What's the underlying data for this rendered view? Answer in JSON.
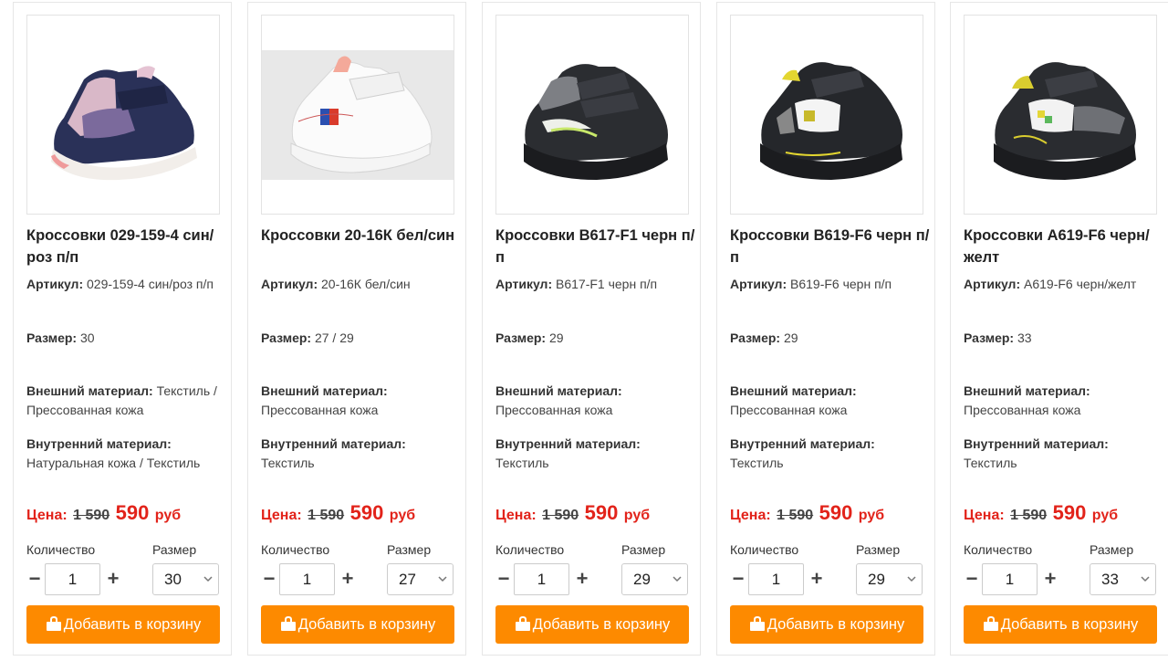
{
  "labels": {
    "article": "Артикул:",
    "size": "Размер:",
    "outer": "Внешний материал:",
    "inner": "Внутренний материал:",
    "price": "Цена:",
    "currency": "руб",
    "qty_label": "Количество",
    "size_label": "Размер",
    "minus": "−",
    "plus": "+",
    "add_to_cart": "Добавить в корзину"
  },
  "icons": {
    "cart": "shopping-bag-icon",
    "select": "chevron-down-icon"
  },
  "colors": {
    "accent_button": "#fd8a00",
    "price_red": "#e2231a"
  },
  "products": [
    {
      "title": "Кроссовки 029-159-4 син/роз п/п",
      "article": "029-159-4 син/роз п/п",
      "size": "30",
      "outer": "Текстиль / Прессованная кожа",
      "inner": "Натуральная кожа / Текстиль",
      "old_price": "1 590",
      "new_price": "590",
      "qty": "1",
      "selected_size": "30"
    },
    {
      "title": "Кроссовки 20-16К бел/син",
      "article": "20-16К бел/син",
      "size": "27 / 29",
      "outer": "Прессованная кожа",
      "inner": "Текстиль",
      "old_price": "1 590",
      "new_price": "590",
      "qty": "1",
      "selected_size": "27"
    },
    {
      "title": "Кроссовки B617-F1 черн п/п",
      "article": "B617-F1 черн п/п",
      "size": "29",
      "outer": "Прессованная кожа",
      "inner": "Текстиль",
      "old_price": "1 590",
      "new_price": "590",
      "qty": "1",
      "selected_size": "29"
    },
    {
      "title": "Кроссовки B619-F6 черн п/п",
      "article": "B619-F6 черн п/п",
      "size": "29",
      "outer": "Прессованная кожа",
      "inner": "Текстиль",
      "old_price": "1 590",
      "new_price": "590",
      "qty": "1",
      "selected_size": "29"
    },
    {
      "title": "Кроссовки A619-F6 черн/желт",
      "article": "A619-F6 черн/желт",
      "size": "33",
      "outer": "Прессованная кожа",
      "inner": "Текстиль",
      "old_price": "1 590",
      "new_price": "590",
      "qty": "1",
      "selected_size": "33"
    }
  ]
}
